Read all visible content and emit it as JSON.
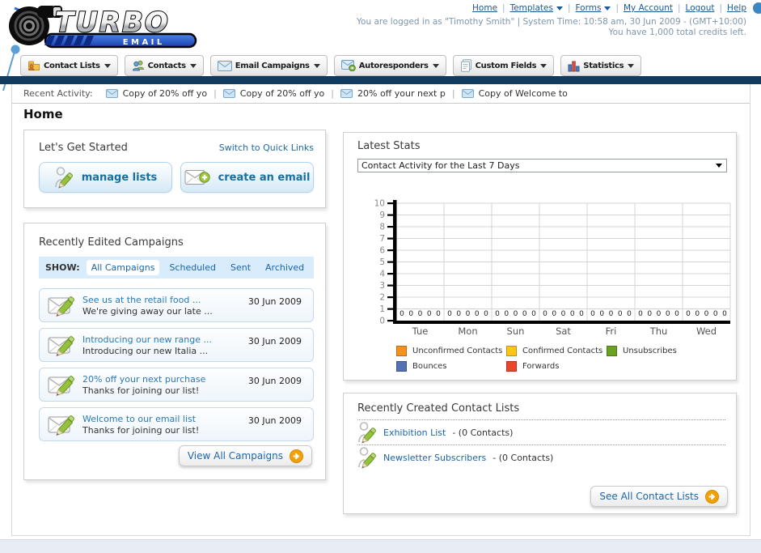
{
  "header": {
    "separator": "|",
    "nav_links": [
      {
        "label": "Home",
        "menu": false
      },
      {
        "label": "Templates",
        "menu": true
      },
      {
        "label": "Forms",
        "menu": true
      },
      {
        "label": "My Account",
        "menu": false
      },
      {
        "label": "Logout",
        "menu": false
      },
      {
        "label": "Help",
        "menu": false
      }
    ],
    "login_line": "You are logged in as \"Timothy Smith\" | System Time: 10:58 am, 30 Jun 2009 - (GMT+10:00)",
    "credits_line": "You have 1,000 total credits left.",
    "logo_title": "TURBO",
    "logo_subtitle": "E M A I L"
  },
  "nav_tabs": [
    {
      "label": "Contact Lists",
      "icon": "folder-user"
    },
    {
      "label": "Contacts",
      "icon": "users"
    },
    {
      "label": "Email Campaigns",
      "icon": "envelope"
    },
    {
      "label": "Autoresponders",
      "icon": "envelope-arrow"
    },
    {
      "label": "Custom Fields",
      "icon": "pages"
    },
    {
      "label": "Statistics",
      "icon": "bar-chart"
    }
  ],
  "recent_activity": {
    "label": "Recent Activity:",
    "items": [
      "Copy of 20% off yo",
      "Copy of 20% off yo",
      "20% off your next p",
      "Copy of Welcome to"
    ]
  },
  "page_title": "Home",
  "get_started": {
    "title": "Let's Get Started",
    "switch_link": "Switch to Quick Links",
    "buttons": [
      {
        "label": "manage lists",
        "icon": "user-pencil"
      },
      {
        "label": "create an email",
        "icon": "envelope-plus"
      }
    ]
  },
  "campaigns": {
    "title": "Recently Edited Campaigns",
    "show_label": "SHOW:",
    "tabs": [
      "All Campaigns",
      "Scheduled",
      "Sent",
      "Archived"
    ],
    "active_tab": "All Campaigns",
    "items": [
      {
        "title": "See us at the retail food ...",
        "subtitle": "We're giving away our late ...",
        "date": "30 Jun 2009"
      },
      {
        "title": "Introducing our new range ...",
        "subtitle": "Introducing our new Italia ...",
        "date": "30 Jun 2009"
      },
      {
        "title": "20% off your next purchase",
        "subtitle": "Thanks for joining our list!",
        "date": "30 Jun 2009"
      },
      {
        "title": "Welcome to our email list",
        "subtitle": "Thanks for joining our list!",
        "date": "30 Jun 2009"
      }
    ],
    "view_all_label": "View All Campaigns"
  },
  "stats": {
    "title": "Latest Stats",
    "dropdown_value": "Contact Activity for the Last 7 Days",
    "chart_data": {
      "type": "bar",
      "title": "Contact Activity for the Last 7 Days",
      "categories": [
        "Tue",
        "Mon",
        "Sun",
        "Sat",
        "Fri",
        "Thu",
        "Wed"
      ],
      "series": [
        {
          "name": "Unconfirmed Contacts",
          "color": "#f5921e",
          "values": [
            0,
            0,
            0,
            0,
            0,
            0,
            0
          ]
        },
        {
          "name": "Confirmed Contacts",
          "color": "#fbc618",
          "values": [
            0,
            0,
            0,
            0,
            0,
            0,
            0
          ]
        },
        {
          "name": "Unsubscribes",
          "color": "#6aa121",
          "values": [
            0,
            0,
            0,
            0,
            0,
            0,
            0
          ]
        },
        {
          "name": "Bounces",
          "color": "#5472b2",
          "values": [
            0,
            0,
            0,
            0,
            0,
            0,
            0
          ]
        },
        {
          "name": "Forwards",
          "color": "#e8472b",
          "values": [
            0,
            0,
            0,
            0,
            0,
            0,
            0
          ]
        }
      ],
      "ylim": [
        0,
        10
      ],
      "yticks": [
        0,
        1,
        2,
        3,
        4,
        5,
        6,
        7,
        8,
        9,
        10
      ],
      "grid": true,
      "legend_position": "bottom"
    }
  },
  "contact_lists": {
    "title": "Recently Created Contact Lists",
    "items": [
      {
        "name": "Exhibition List",
        "count": "- (0 Contacts)"
      },
      {
        "name": "Newsletter Subscribers",
        "count": "- (0 Contacts)"
      }
    ],
    "see_all_label": "See All Contact Lists"
  }
}
